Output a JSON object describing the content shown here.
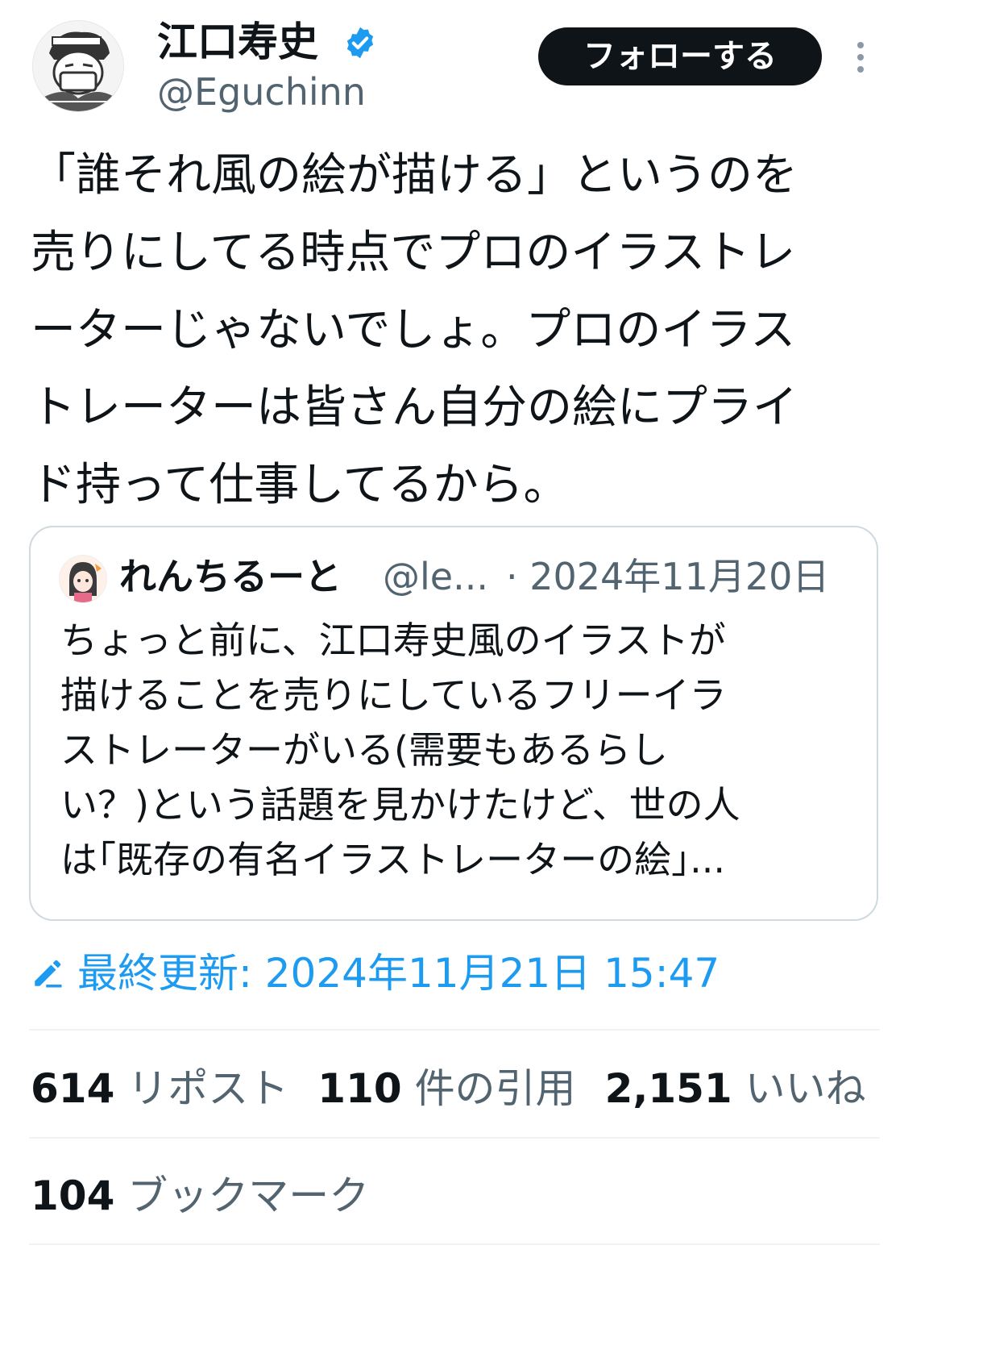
{
  "author": {
    "name": "江口寿史",
    "handle": "@Eguchinn",
    "avatar_icon": "manga-avatar-icon",
    "verified_icon": "verified-badge-icon"
  },
  "follow_label": "フォローする",
  "more_icon": "more-vertical-icon",
  "tweet_lines": [
    "「誰それ風の絵が描ける」というのを",
    "売りにしてる時点でプロのイラストレ",
    "ーターじゃないでしょ。プロのイラス",
    "トレーターは皆さん自分の絵にプライ",
    "ド持って仕事してるから。"
  ],
  "quote": {
    "name": "れんちるーと",
    "handle": "@le...",
    "date": "· 2024年11月20日",
    "lines": [
      "ちょっと前に、江口寿史風のイラストが",
      "描けることを売りにしているフリーイラ",
      "ストレーターがいる(需要もあるらし",
      "い？)という話題を見かけたけど、世の人",
      "は｢既存の有名イラストレーターの絵｣..."
    ]
  },
  "edited_label": "最終更新: 2024年11月21日 15:47",
  "edit_icon": "pencil-icon",
  "stats": {
    "reposts_count": "614",
    "reposts_label": "リポスト",
    "quotes_count": "110",
    "quotes_label": "件の引用",
    "likes_count": "2,151",
    "likes_label": "いいね",
    "bookmarks_count": "104",
    "bookmarks_label": "ブックマーク"
  },
  "colors": {
    "accent": "#1d9bf0",
    "text": "#0f1419",
    "secondary": "#536471",
    "border": "#cfd9de"
  }
}
